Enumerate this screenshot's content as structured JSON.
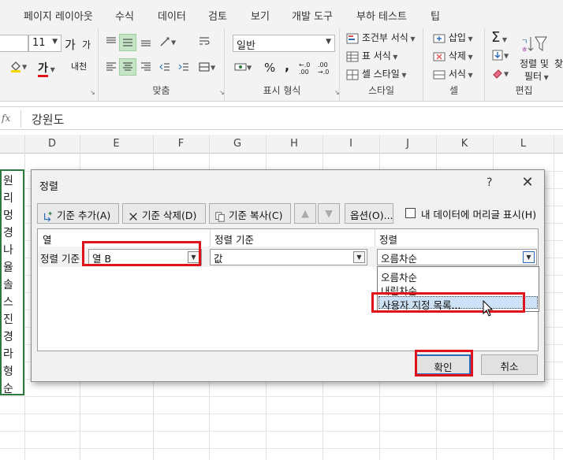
{
  "ribbon": {
    "tabs": [
      "페이지 레이아웃",
      "수식",
      "데이터",
      "검토",
      "보기",
      "개발 도구",
      "부하 테스트",
      "팁"
    ],
    "font_size": "11",
    "font_grow": "가",
    "font_shrink": "가",
    "font_color_label": "가",
    "phonetic_label": "내천",
    "alignment_group_label": "맞춤",
    "number_format_value": "일반",
    "percent_label": "%",
    "comma_label": ",",
    "inc_decimal": "←.0 .00",
    "dec_decimal": ".00 →.0",
    "number_group_label": "표시 형식",
    "cond_format_label": "조건부 서식",
    "table_format_label": "표 서식",
    "cell_style_label": "셀 스타일",
    "style_group_label": "스타일",
    "insert_label": "삽입",
    "delete_label": "삭제",
    "format_label": "서식",
    "cells_group_label": "셀",
    "sort_filter_label_1": "정렬 및",
    "sort_filter_label_2": "필터",
    "find_label": "찾",
    "edit_group_label": "편집"
  },
  "formula_bar": {
    "fx_label": "fx",
    "value": "강원도"
  },
  "grid": {
    "columns": [
      "D",
      "E",
      "F",
      "G",
      "H",
      "I",
      "J",
      "K",
      "L"
    ],
    "left_cells": [
      "원",
      "리",
      "멍",
      "경",
      "나",
      "율",
      "솔",
      "스",
      "진",
      "경",
      "라",
      "형",
      "순"
    ]
  },
  "dialog": {
    "title": "정렬",
    "help": "?",
    "close": "✕",
    "toolbar": {
      "add_level": "기준 추가(A)",
      "delete_level": "기준 삭제(D)",
      "copy_level": "기준 복사(C)",
      "options": "옵션(O)...",
      "header_checkbox_label": "내 데이터에 머리글 표시(H)",
      "header_checked": false
    },
    "headers": {
      "column": "열",
      "sort_on": "정렬 기준",
      "order": "정렬"
    },
    "row": {
      "label": "정렬 기준",
      "column_value": "열 B",
      "sort_on_value": "값",
      "order_value": "오름차순"
    },
    "order_options": [
      "오름차순",
      "내림차순",
      "사용자 지정 목록..."
    ],
    "ok": "확인",
    "cancel": "취소"
  },
  "colors": {
    "highlight_red": "#e0121b",
    "selection_green": "#2c7a3c",
    "focus_blue": "#2a6ab8"
  }
}
